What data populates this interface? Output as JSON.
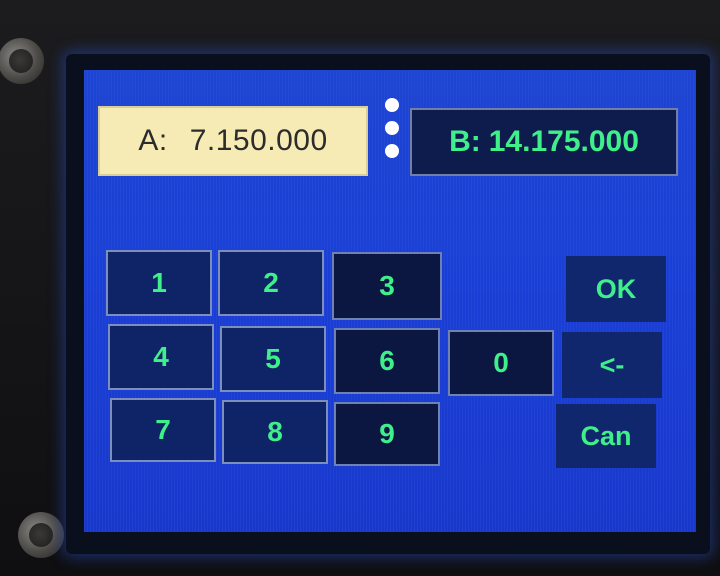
{
  "display": {
    "vfo_a": {
      "label": "A:",
      "frequency": "7.150.000"
    },
    "vfo_b": {
      "label": "B:",
      "frequency": "14.175.000"
    }
  },
  "keypad": {
    "keys": [
      "1",
      "2",
      "3",
      "4",
      "5",
      "6",
      "7",
      "8",
      "9",
      "0"
    ],
    "ok_label": "OK",
    "backspace_label": "<-",
    "cancel_label": "Can"
  },
  "colors": {
    "screen_background": "#1a3fd6",
    "key_text": "#3ff08a",
    "vfo_a_background": "#f6ebb5"
  },
  "icons": {
    "menu": "vertical-dots-icon"
  }
}
